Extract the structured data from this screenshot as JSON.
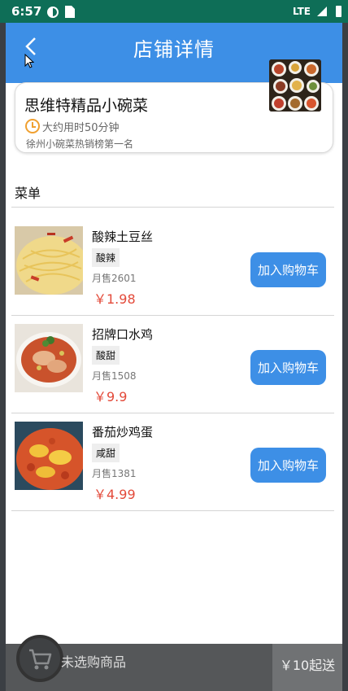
{
  "status_bar": {
    "time": "6:57",
    "network": "LTE"
  },
  "header": {
    "title": "店铺详情"
  },
  "shop": {
    "name": "思维特精品小碗菜",
    "delivery_time": "大约用时50分钟",
    "slogan": "徐州小碗菜热销榜第一名"
  },
  "menu": {
    "label": "菜单",
    "items": [
      {
        "name": "酸辣土豆丝",
        "tag": "酸辣",
        "sales": "月售2601",
        "price": "￥1.98",
        "add_label": "加入购物车"
      },
      {
        "name": "招牌口水鸡",
        "tag": "酸甜",
        "sales": "月售1508",
        "price": "￥9.9",
        "add_label": "加入购物车"
      },
      {
        "name": "番茄炒鸡蛋",
        "tag": "咸甜",
        "sales": "月售1381",
        "price": "￥4.99",
        "add_label": "加入购物车"
      }
    ]
  },
  "cart": {
    "status": "未选购商品",
    "min_delivery": "￥10起送"
  },
  "colors": {
    "accent": "#3d8fe6",
    "price": "#e34a3a",
    "statusbar": "#0e6e57"
  }
}
